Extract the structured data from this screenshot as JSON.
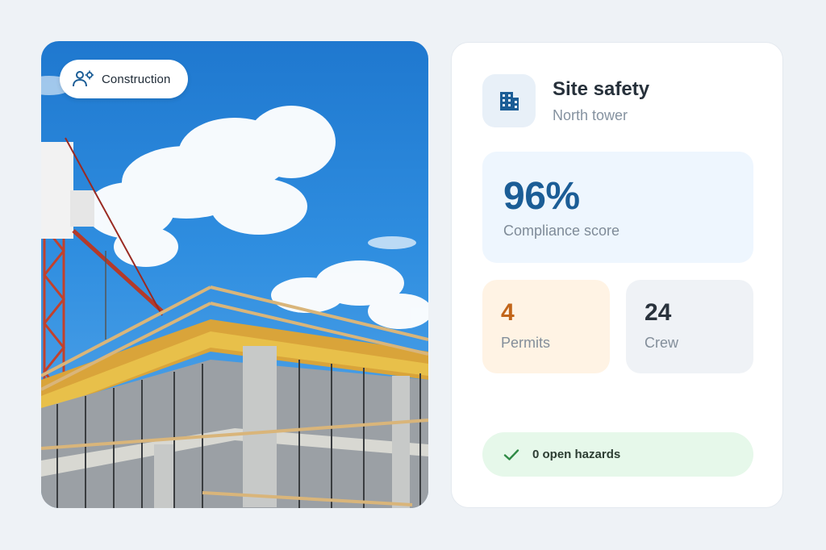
{
  "photo": {
    "category_label": "Construction",
    "category_icon": "engineer-gear-icon"
  },
  "site": {
    "icon": "building-icon",
    "title": "Site safety",
    "subtitle": "North tower"
  },
  "compliance": {
    "value": "96%",
    "label": "Compliance score"
  },
  "stats": {
    "permits": {
      "value": "4",
      "label": "Permits"
    },
    "crew": {
      "value": "24",
      "label": "Crew"
    }
  },
  "hazards": {
    "icon": "checkmark-icon",
    "label": "0 open hazards"
  },
  "colors": {
    "accent_blue": "#1b5d96",
    "permits_orange": "#c2651a",
    "hazard_green": "#2f8a45"
  }
}
